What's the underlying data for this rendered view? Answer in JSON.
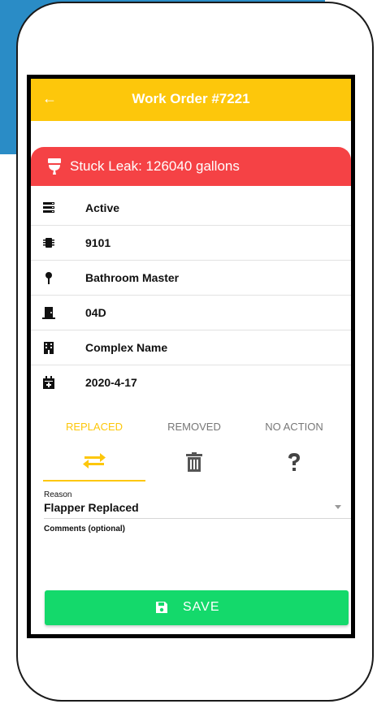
{
  "header": {
    "back_icon": "←",
    "title": "Work Order #7221"
  },
  "alert": {
    "icon": "toilet-icon",
    "text": "Stuck Leak: 126040 gallons",
    "color": "#f54245"
  },
  "details": [
    {
      "icon": "status-icon",
      "text": "Active"
    },
    {
      "icon": "meter-icon",
      "text": "9101"
    },
    {
      "icon": "location-pin-icon",
      "text": "Bathroom Master"
    },
    {
      "icon": "door-icon",
      "text": "04D"
    },
    {
      "icon": "building-icon",
      "text": "Complex Name"
    },
    {
      "icon": "calendar-icon",
      "text": "2020-4-17"
    }
  ],
  "tabs": [
    {
      "label": "REPLACED",
      "icon": "swap-arrows-icon",
      "active": true
    },
    {
      "label": "REMOVED",
      "icon": "trash-icon",
      "active": false
    },
    {
      "label": "NO ACTION",
      "icon": "question-icon",
      "active": false
    }
  ],
  "reason": {
    "caption": "Reason",
    "value": "Flapper Replaced"
  },
  "comments": {
    "label": "Comments (optional)"
  },
  "save": {
    "label": "SAVE",
    "icon": "floppy-disk-icon",
    "color": "#14d96b"
  },
  "colors": {
    "accent": "#fdc70b",
    "background_blue": "#2a8cc6"
  }
}
